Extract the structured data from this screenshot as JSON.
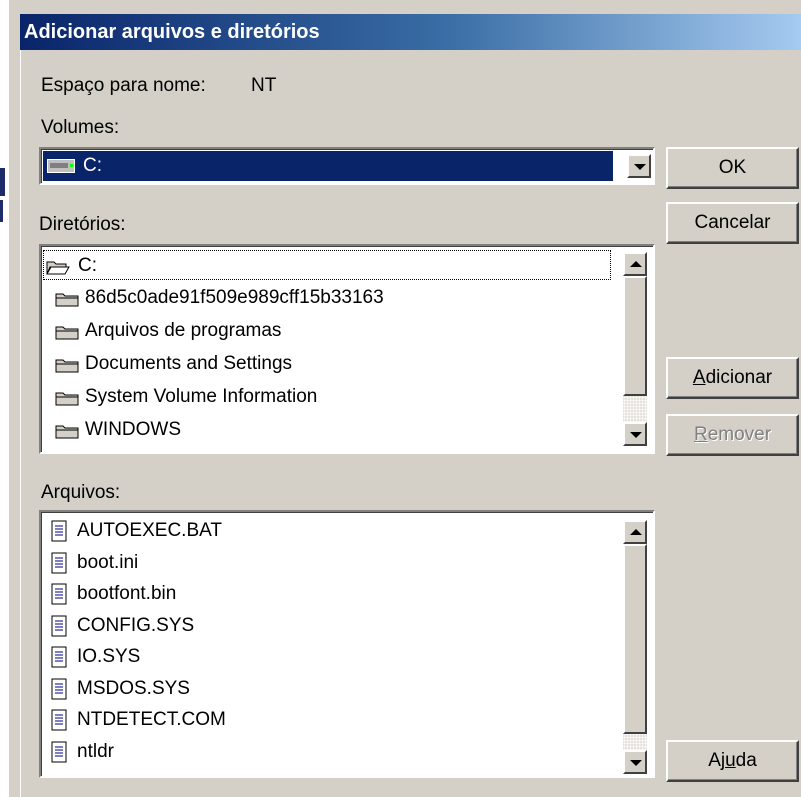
{
  "window": {
    "title": "Adicionar arquivos e diretórios"
  },
  "namespace": {
    "label": "Espaço para nome:",
    "value": "NT"
  },
  "volumes": {
    "label": "Volumes:",
    "selected": "C:"
  },
  "directories": {
    "label": "Diretórios:",
    "items": [
      {
        "label": "C:",
        "icon": "open-folder-icon"
      },
      {
        "label": "86d5c0ade91f509e989cff15b33163",
        "icon": "folder-icon"
      },
      {
        "label": "Arquivos de programas",
        "icon": "folder-icon"
      },
      {
        "label": "Documents and Settings",
        "icon": "folder-icon"
      },
      {
        "label": "System Volume Information",
        "icon": "folder-icon"
      },
      {
        "label": "WINDOWS",
        "icon": "folder-icon"
      }
    ]
  },
  "files": {
    "label": "Arquivos:",
    "items": [
      {
        "label": "AUTOEXEC.BAT",
        "icon": "file-icon"
      },
      {
        "label": "boot.ini",
        "icon": "file-icon"
      },
      {
        "label": "bootfont.bin",
        "icon": "file-icon"
      },
      {
        "label": "CONFIG.SYS",
        "icon": "file-icon"
      },
      {
        "label": "IO.SYS",
        "icon": "file-icon"
      },
      {
        "label": "MSDOS.SYS",
        "icon": "file-icon"
      },
      {
        "label": "NTDETECT.COM",
        "icon": "file-icon"
      },
      {
        "label": "ntldr",
        "icon": "file-icon"
      }
    ]
  },
  "buttons": {
    "ok": "OK",
    "cancel": "Cancelar",
    "add_prefix": "",
    "add_ul": "A",
    "add_rest": "dicionar",
    "remove_ul": "R",
    "remove_rest": "emover",
    "help_pre": "Aj",
    "help_ul": "u",
    "help_rest": "da"
  },
  "colors": {
    "selection": "#0a246a",
    "face": "#d4d0c8",
    "title_start": "#0a246a",
    "title_end": "#a6caf0"
  }
}
